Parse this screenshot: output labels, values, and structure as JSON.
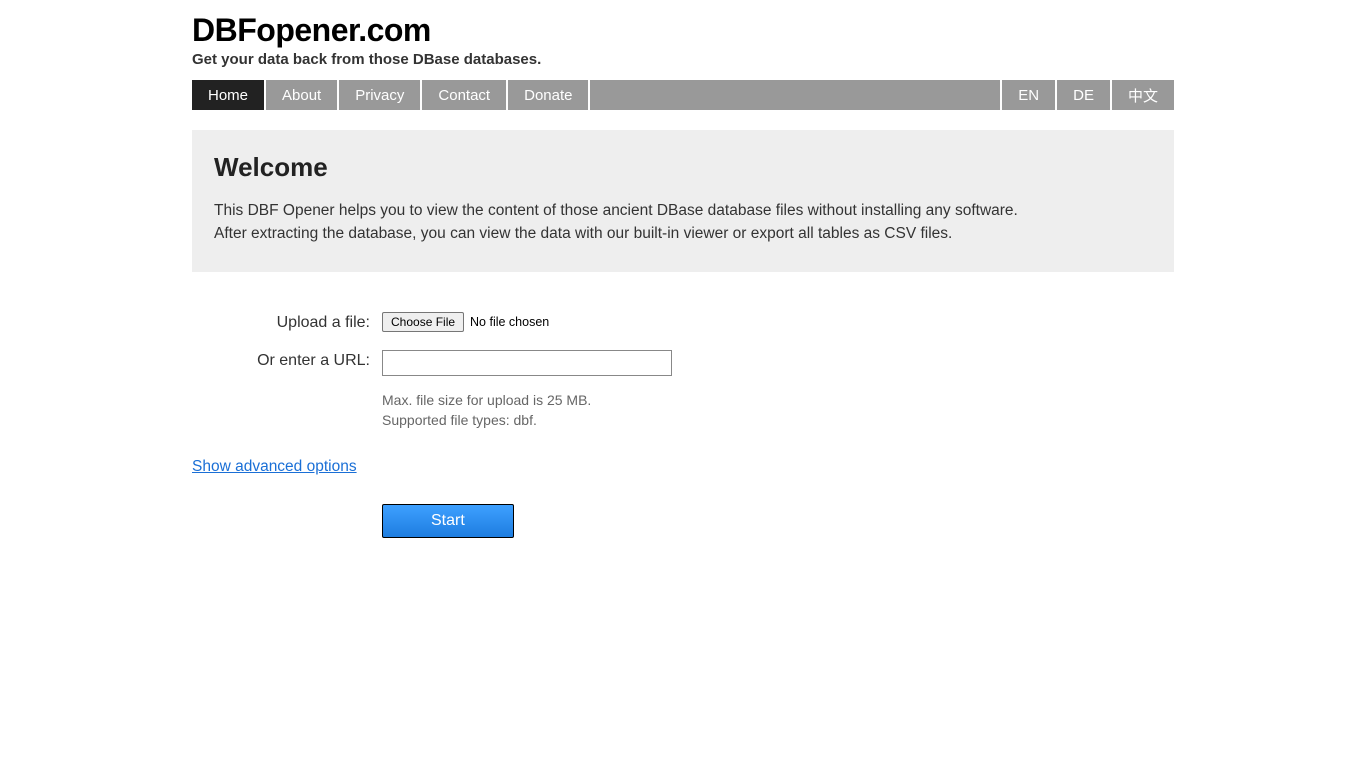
{
  "header": {
    "site_title": "DBFopener.com",
    "tagline": "Get your data back from those DBase databases."
  },
  "nav": {
    "items": [
      {
        "label": "Home",
        "active": true
      },
      {
        "label": "About",
        "active": false
      },
      {
        "label": "Privacy",
        "active": false
      },
      {
        "label": "Contact",
        "active": false
      },
      {
        "label": "Donate",
        "active": false
      }
    ],
    "languages": [
      {
        "label": "EN"
      },
      {
        "label": "DE"
      },
      {
        "label": "中文"
      }
    ]
  },
  "welcome": {
    "heading": "Welcome",
    "line1": "This DBF Opener helps you to view the content of those ancient DBase database files without installing any software.",
    "line2": "After extracting the database, you can view the data with our built-in viewer or export all tables as CSV files."
  },
  "form": {
    "upload_label": "Upload a file:",
    "choose_file": "Choose File",
    "no_file": "No file chosen",
    "url_label": "Or enter a URL:",
    "url_value": "",
    "hint_size": "Max. file size for upload is 25 MB.",
    "hint_types": "Supported file types: dbf.",
    "advanced_link": "Show advanced options",
    "start_button": "Start"
  }
}
